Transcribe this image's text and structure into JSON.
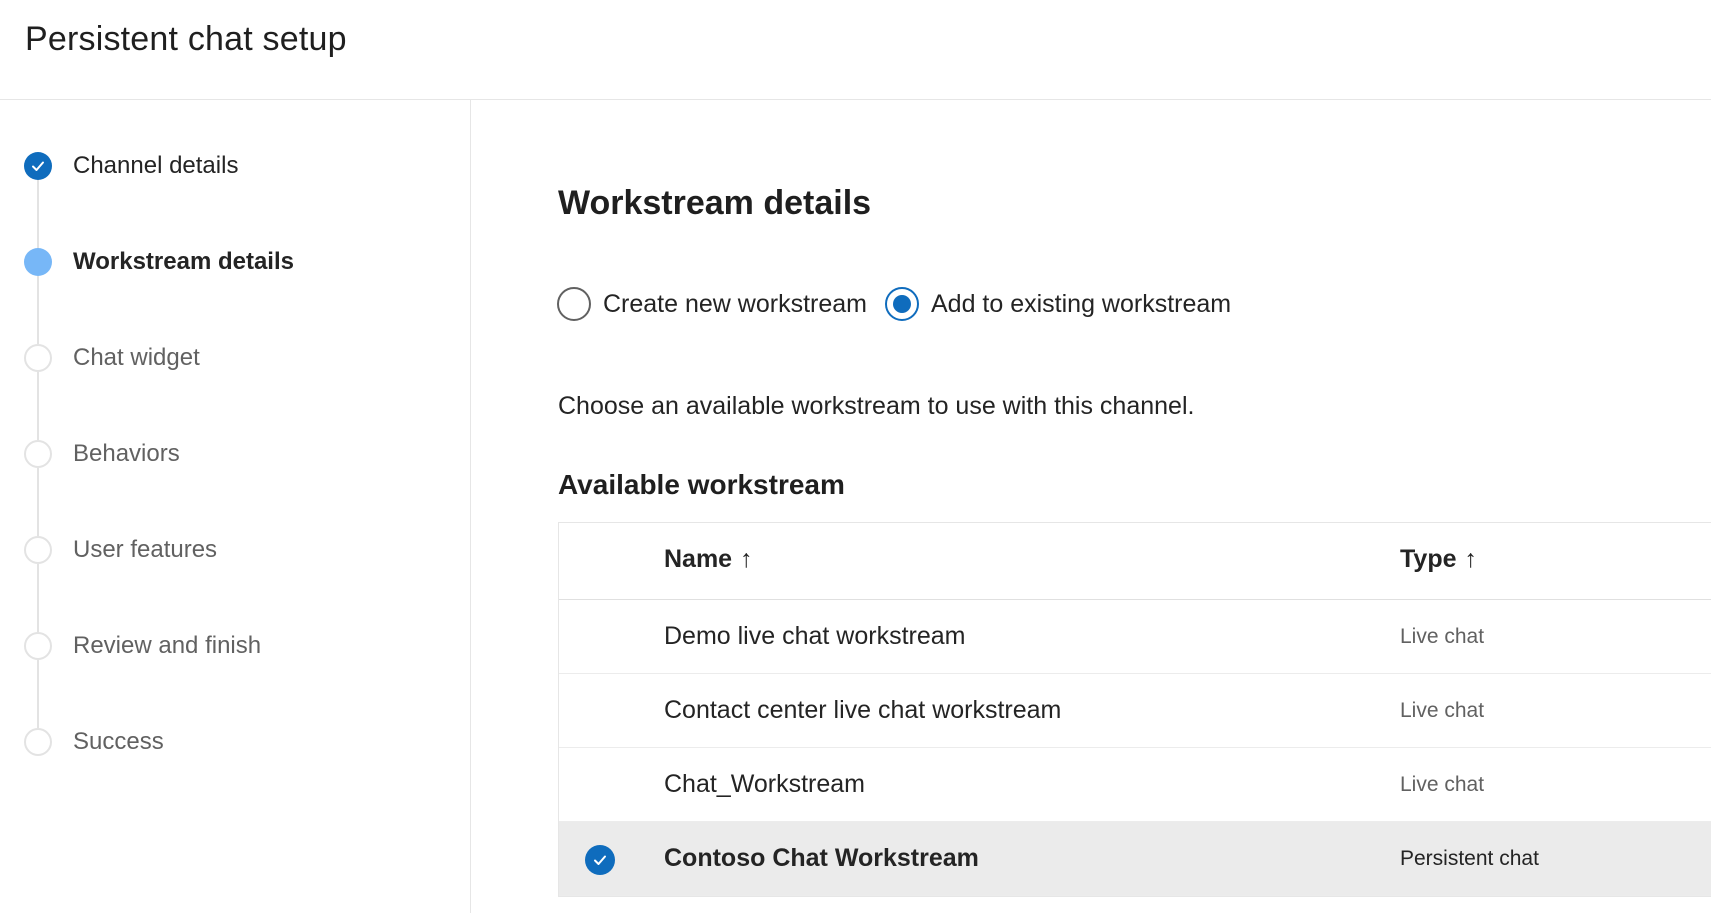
{
  "app": {
    "title": "Persistent chat setup"
  },
  "steps": [
    {
      "label": "Channel details",
      "state": "done"
    },
    {
      "label": "Workstream details",
      "state": "current"
    },
    {
      "label": "Chat widget",
      "state": "pending"
    },
    {
      "label": "Behaviors",
      "state": "pending"
    },
    {
      "label": "User features",
      "state": "pending"
    },
    {
      "label": "Review and finish",
      "state": "pending"
    },
    {
      "label": "Success",
      "state": "pending"
    }
  ],
  "main": {
    "title": "Workstream details",
    "options": [
      {
        "label": "Create new workstream",
        "checked": false
      },
      {
        "label": "Add to existing workstream",
        "checked": true
      }
    ],
    "instruction": "Choose an available workstream to use with this channel.",
    "table_title": "Available workstream",
    "columns": {
      "name": "Name",
      "type": "Type",
      "sort_icon": "↑"
    },
    "rows": [
      {
        "name": "Demo live chat workstream",
        "type": "Live chat",
        "selected": false
      },
      {
        "name": "Contact center live chat workstream",
        "type": "Live chat",
        "selected": false
      },
      {
        "name": "Chat_Workstream",
        "type": "Live chat",
        "selected": false
      },
      {
        "name": "Contoso Chat Workstream",
        "type": "Persistent chat",
        "selected": true
      }
    ]
  },
  "colors": {
    "accent": "#0f6cbd",
    "current_step": "#77b7f7",
    "selected_row": "#ebebeb"
  },
  "icons": {
    "step_done": "checkmark-circle-icon",
    "row_selected": "checkmark-circle-icon",
    "sort": "arrow-up-icon"
  }
}
